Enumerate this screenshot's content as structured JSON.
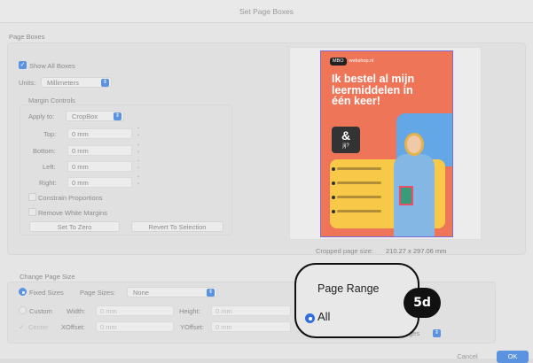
{
  "window": {
    "title": "Set Page Boxes"
  },
  "page_boxes": {
    "group_label": "Page Boxes",
    "show_all_boxes_label": "Show All Boxes",
    "show_all_boxes_checked": true,
    "units_label": "Units:",
    "units_value": "Millimeters",
    "margin_controls": {
      "label": "Margin Controls",
      "apply_to_label": "Apply to:",
      "apply_to_value": "CropBox",
      "top_label": "Top:",
      "top_value": "0 mm",
      "bottom_label": "Bottom:",
      "bottom_value": "0 mm",
      "left_label": "Left:",
      "left_value": "0 mm",
      "right_label": "Right:",
      "right_value": "0 mm",
      "constrain_label": "Constrain Proportions",
      "remove_white_label": "Remove White Margins",
      "set_to_zero_label": "Set To Zero",
      "revert_label": "Revert To Selection"
    },
    "cropped_size_label": "Cropped page size:",
    "cropped_size_value": "210.27 x 297.06 mm"
  },
  "preview": {
    "logo_text": "webshop.nl",
    "headline": "Ik bestel al mijn leermiddelen in één keer!",
    "speech": "&",
    "speech_sub": "jij?"
  },
  "change_page_size": {
    "group_label": "Change Page Size",
    "fixed_sizes_label": "Fixed Sizes",
    "page_sizes_label": "Page Sizes:",
    "page_sizes_value": "None",
    "custom_label": "Custom",
    "width_label": "Width:",
    "width_value": "0 mm",
    "height_label": "Height:",
    "height_value": "0 mm",
    "center_label": "Center",
    "xoffset_label": "XOffset:",
    "xoffset_value": "0 mm",
    "yoffset_label": "YOffset:",
    "yoffset_value": "0 mm",
    "pages_select_value": "ges"
  },
  "callout": {
    "title": "Page Range",
    "option": "All",
    "badge": "5d"
  },
  "footer": {
    "cancel_label": "Cancel",
    "ok_label": "OK"
  },
  "colors": {
    "accent": "#5b93e0",
    "poster_bg": "#ef7558",
    "poster_yellow": "#f8c948",
    "poster_blue": "#63a7e6"
  }
}
